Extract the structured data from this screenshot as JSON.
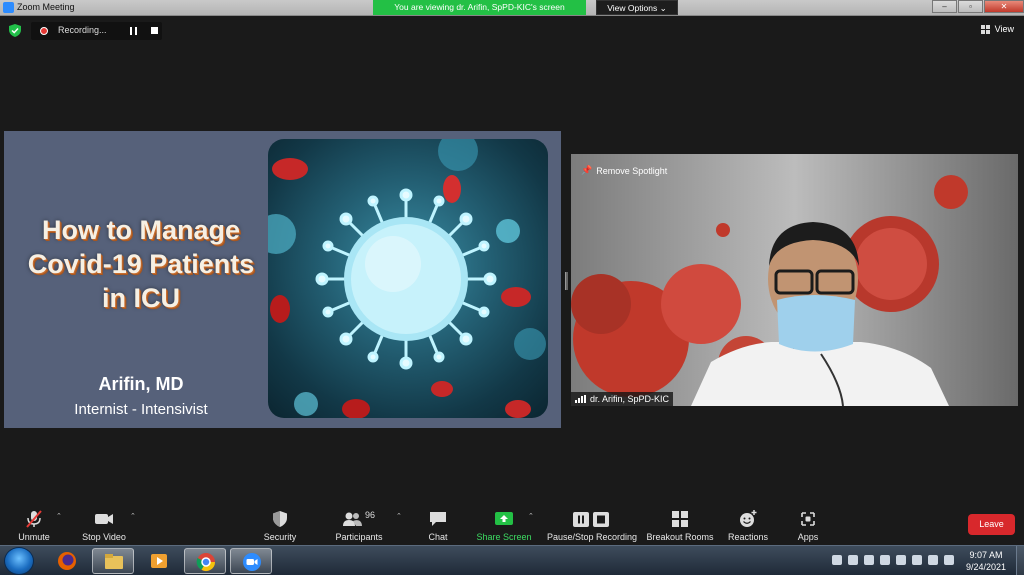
{
  "window": {
    "title": "Zoom Meeting",
    "viewing_banner": "You are viewing dr. Arifin, SpPD-KIC's screen",
    "view_options": "View Options",
    "minimize": "–",
    "maximize": "▫",
    "close": "✕"
  },
  "meeting_bar": {
    "recording_label": "Recording...",
    "view_label": "View"
  },
  "slide": {
    "title_line1": "How to Manage",
    "title_line2": "Covid-19 Patients",
    "title_line3": "in ICU",
    "author": "Arifin, MD",
    "role": "Internist - Intensivist"
  },
  "video": {
    "remove_spotlight": "Remove Spotlight",
    "participant_name": "dr. Arifin, SpPD-KIC"
  },
  "toolbar": {
    "unmute": "Unmute",
    "stop_video": "Stop Video",
    "security": "Security",
    "participants": "Participants",
    "participants_count": "96",
    "chat": "Chat",
    "share_screen": "Share Screen",
    "pause_stop_recording": "Pause/Stop Recording",
    "breakout_rooms": "Breakout Rooms",
    "reactions": "Reactions",
    "apps": "Apps",
    "leave": "Leave"
  },
  "taskbar": {
    "time": "9:07 AM",
    "date": "9/24/2021"
  },
  "colors": {
    "share_green": "#23c045",
    "leave_red": "#d8282c",
    "recording_red": "#e53935"
  }
}
